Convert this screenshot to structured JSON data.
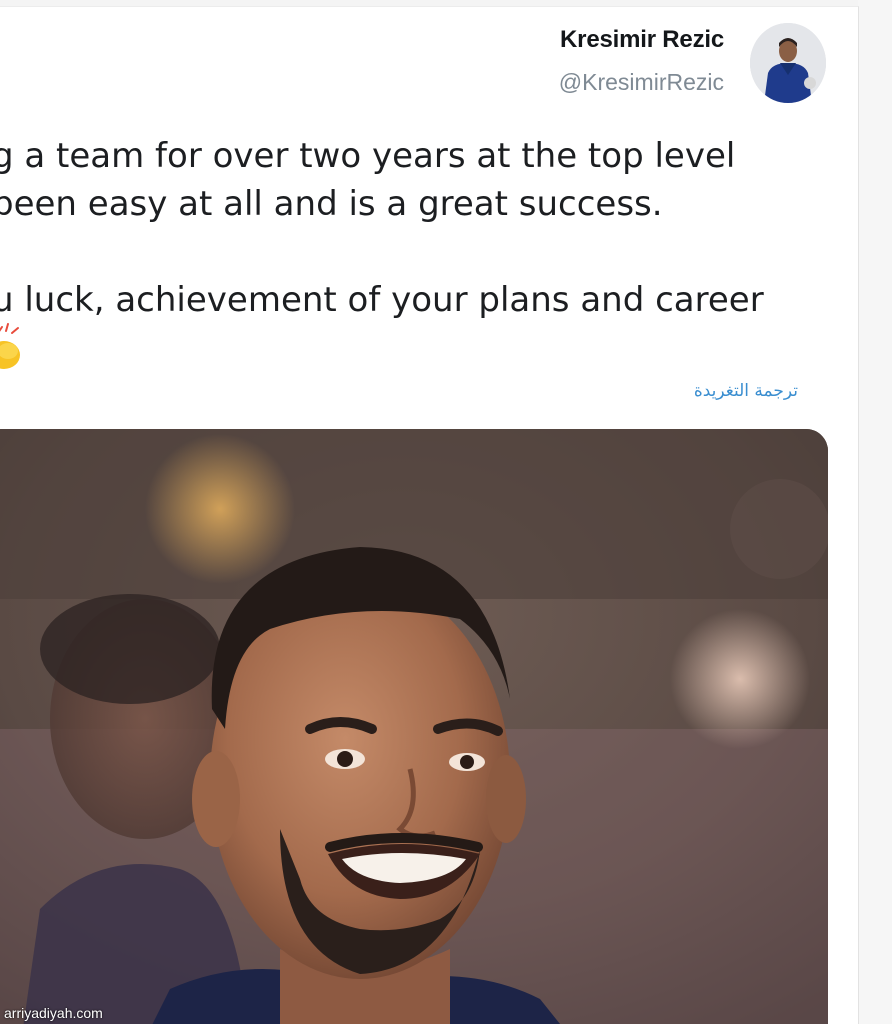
{
  "tweet": {
    "author": {
      "display_name": "Kresimir Rezic",
      "handle": "@KresimirRezic"
    },
    "text_lines": [
      "g a team for over two years at the top level",
      "been easy at all and is a great success."
    ],
    "text_lines_2": [
      "u luck, achievement of your plans and career"
    ],
    "emoji": "clapping-hands",
    "translate_label": "ترجمة التغريدة",
    "media": {
      "description_icon": "photo-smiling-player"
    }
  },
  "watermark": "arriyadiyah.com",
  "colors": {
    "link": "#3a8ed0",
    "handle": "#7f8a94",
    "text": "#1c1e21"
  }
}
